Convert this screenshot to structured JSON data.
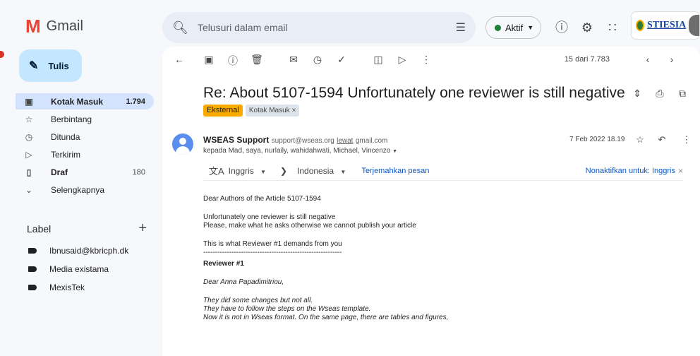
{
  "header": {
    "app_name": "Gmail",
    "search_placeholder": "Telusuri dalam email",
    "status_label": "Aktif",
    "brand_text": "STIESIA",
    "colors": {
      "accent": "#0b57d0",
      "compose_bg": "#c2e7ff",
      "active_nav_bg": "#d3e3fd",
      "status_green": "#188038",
      "external_chip": "#f9ab00"
    }
  },
  "sidebar": {
    "compose_label": "Tulis",
    "items": [
      {
        "label": "Kotak Masuk",
        "count": "1.794",
        "icon": "inbox-icon"
      },
      {
        "label": "Berbintang",
        "count": "",
        "icon": "star-icon"
      },
      {
        "label": "Ditunda",
        "count": "",
        "icon": "clock-icon"
      },
      {
        "label": "Terkirim",
        "count": "",
        "icon": "send-icon"
      },
      {
        "label": "Draf",
        "count": "180",
        "icon": "draft-icon"
      },
      {
        "label": "Selengkapnya",
        "count": "",
        "icon": "chevron-down-icon"
      }
    ],
    "labels_title": "Label",
    "labels": [
      {
        "label": "Ibnusaid@kbricph.dk"
      },
      {
        "label": "Media existama"
      },
      {
        "label": "MexisTek"
      }
    ]
  },
  "toolbar": {
    "pager": "15 dari 7.783"
  },
  "message": {
    "subject": "Re: About 5107-1594 Unfortunately one reviewer is still negative",
    "chip_external": "Eksternal",
    "chip_inbox": "Kotak Masuk",
    "chip_close": "×",
    "sender_name": "WSEAS Support",
    "sender_email": "support@wseas.org",
    "via_label": "lewat",
    "via_domain": "gmail.com",
    "recipients": "kepada Mad, saya, nurlaily, wahidahwati, Michael, Vincenzo",
    "date": "7 Feb 2022 18.19",
    "translate": {
      "from_lang": "Inggris",
      "to_lang": "Indonesia",
      "translate_link": "Terjemahkan pesan",
      "disable_link": "Nonaktifkan untuk: Inggris",
      "close": "×"
    },
    "body": {
      "greeting": "Dear Authors of the Article  5107-1594",
      "line1": "Unfortunately one reviewer is still negative",
      "line2": "Please, make what he asks otherwise we cannot publish your article",
      "line3": "This is what Reviewer #1 demands from you",
      "separator": "-----------------------------------------------------------",
      "reviewer_heading": "Reviewer #1",
      "reviewer_greeting": "Dear Anna Papadimitriou,",
      "r_line1": "They did some changes but not all.",
      "r_line2": "They have to follow the steps on the Wseas template.",
      "r_line3": "Now it is not in Wseas format. On the same page, there are tables and figures,"
    }
  }
}
